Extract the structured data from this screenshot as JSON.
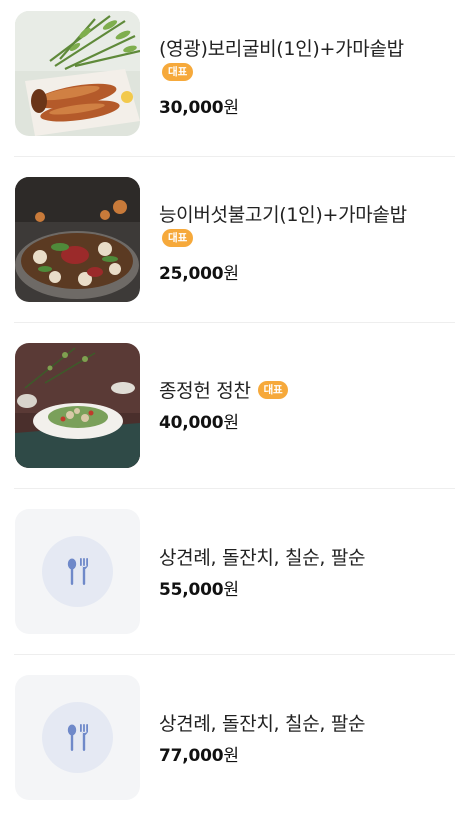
{
  "menu": {
    "items": [
      {
        "name": "(영광)보리굴비(1인)+가마솥밥",
        "badge": "대표",
        "price": "30,000",
        "unit": "원"
      },
      {
        "name": "능이버섯불고기(1인)+가마솥밥",
        "badge": "대표",
        "price": "25,000",
        "unit": "원"
      },
      {
        "name": "종정헌 정찬",
        "badge": "대표",
        "price": "40,000",
        "unit": "원"
      },
      {
        "name": "상견례, 돌잔치, 칠순, 팔순",
        "badge": "",
        "price": "55,000",
        "unit": "원"
      },
      {
        "name": "상견례, 돌잔치, 칠순, 팔순",
        "badge": "",
        "price": "77,000",
        "unit": "원"
      }
    ]
  },
  "colors": {
    "badge": "#f6a93b",
    "divider": "#eeeeee",
    "placeholder_bg": "#f4f5f7",
    "placeholder_icon": "#6f89c9"
  },
  "icons": {
    "placeholder": "fork-spoon-icon"
  }
}
